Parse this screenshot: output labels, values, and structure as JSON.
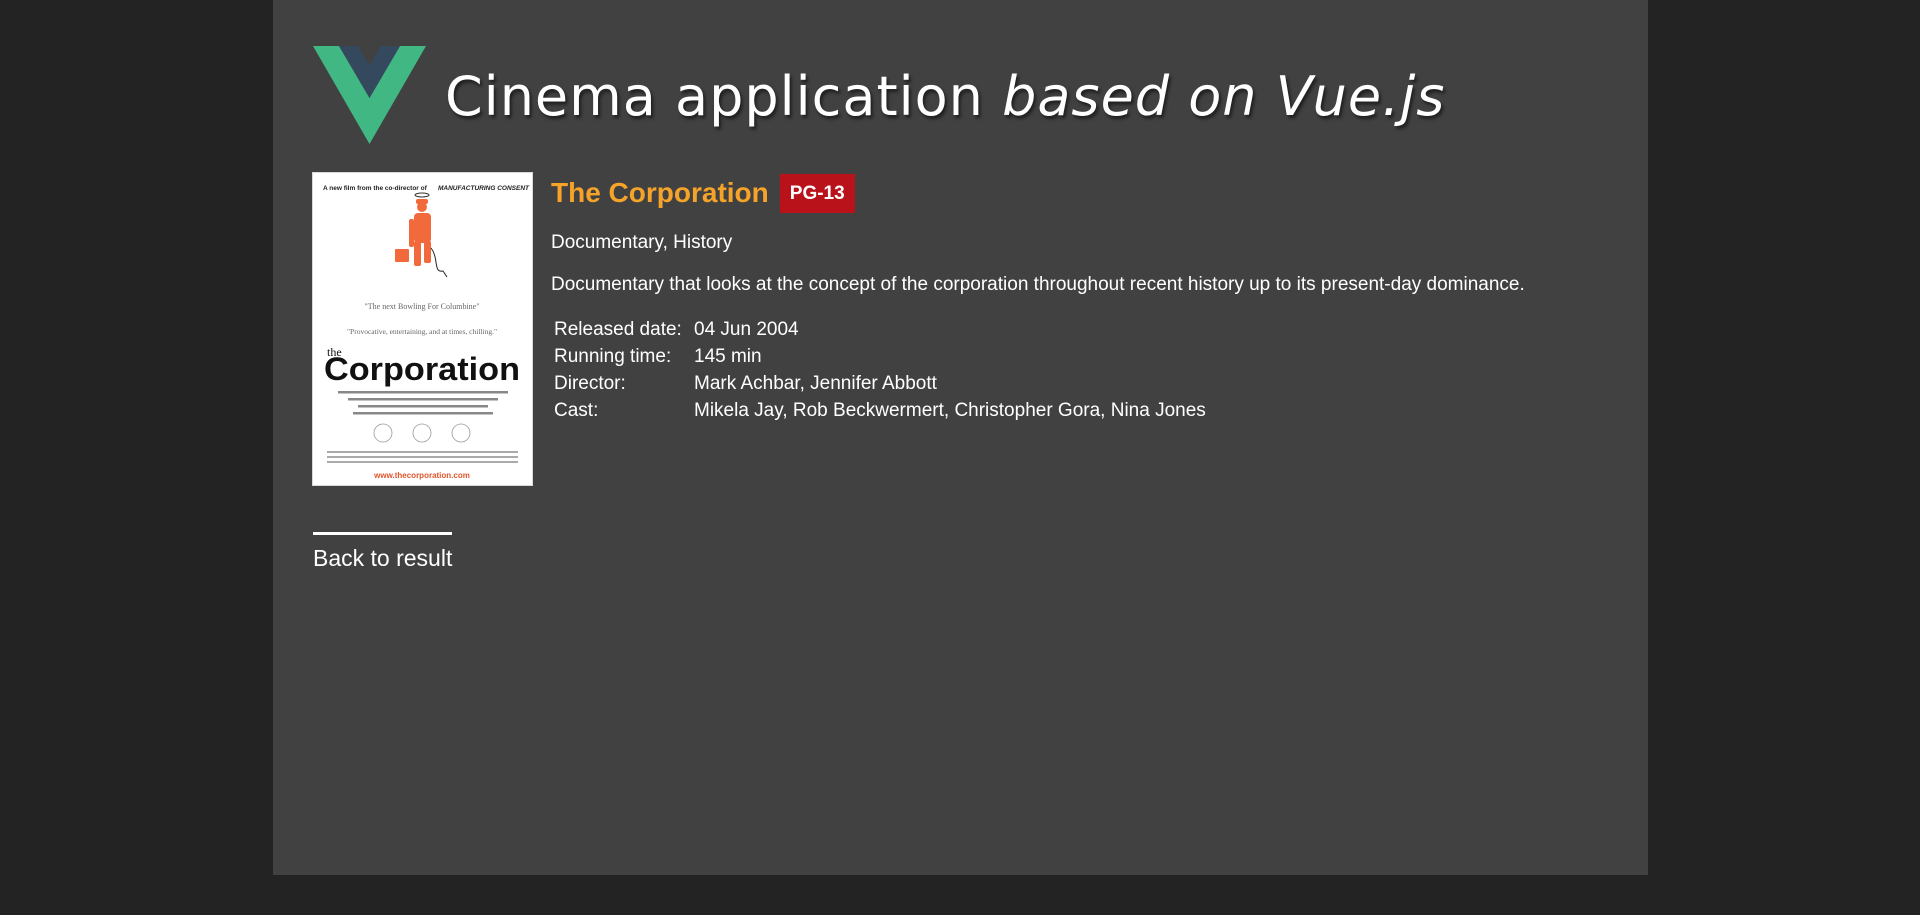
{
  "header": {
    "title_main": "Cinema application",
    "title_em": "based on Vue.js",
    "logo_icon": "vue-logo-icon",
    "logo_colors": {
      "outer": "#41b883",
      "inner": "#35495e"
    }
  },
  "movie": {
    "title": "The Corporation",
    "rating": "PG-13",
    "genres": "Documentary, History",
    "description": "Documentary that looks at the concept of the corporation throughout recent history up to its present-day dominance.",
    "info": [
      {
        "label": "Released date:",
        "value": "04 Jun 2004"
      },
      {
        "label": "Running time:",
        "value": "145 min"
      },
      {
        "label": "Director:",
        "value": "Mark Achbar, Jennifer Abbott"
      },
      {
        "label": "Cast:",
        "value": "Mikela Jay, Rob Beckwermert, Christopher Gora, Nina Jones"
      }
    ]
  },
  "poster": {
    "top_left": "A new film from the co-director of",
    "top_right": "MANUFACTURING CONSENT",
    "quote1": "\"The next Bowling For Columbine\"",
    "quote2": "\"Provocative, entertaining, and at times, chilling.\"",
    "title_small": "the",
    "title_big": "Corporation",
    "url": "www.thecorporation.com"
  },
  "navigation": {
    "back_label": "Back to result"
  },
  "colors": {
    "page_background": "#232323",
    "panel_background": "#414141",
    "title_accent": "#f6a32a",
    "rating_badge": "#b9121b"
  }
}
